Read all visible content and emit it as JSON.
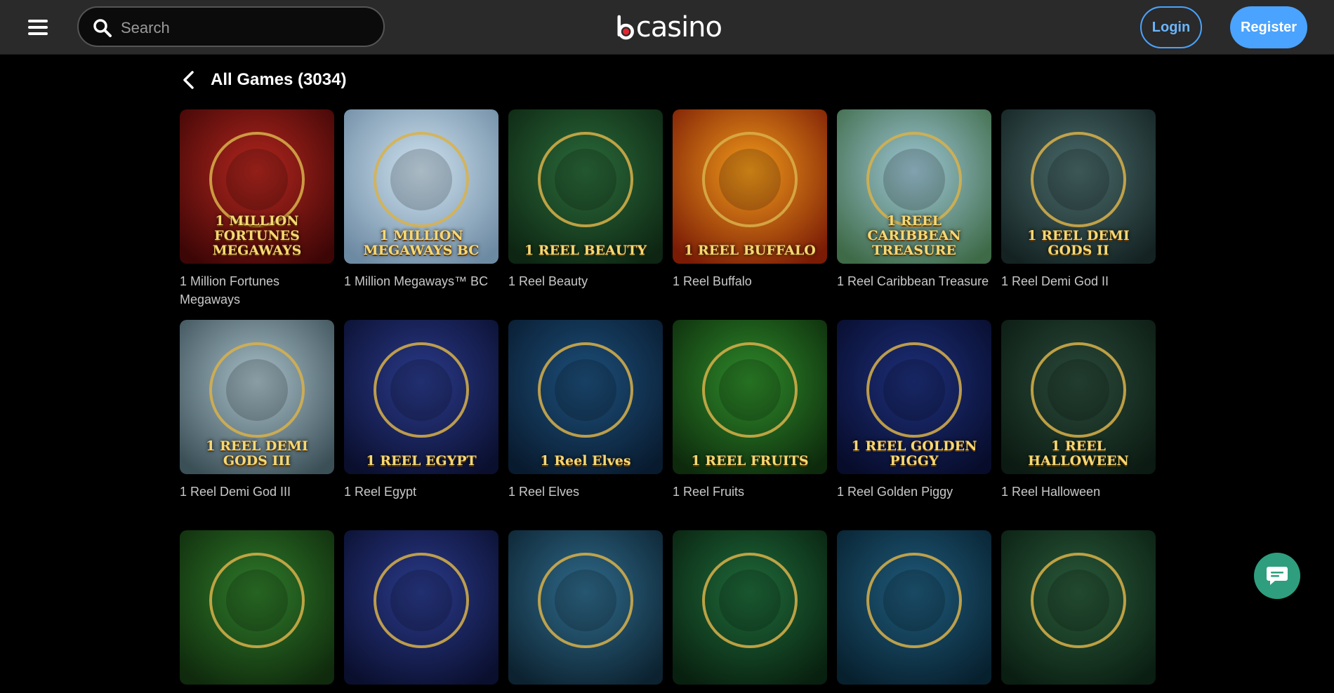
{
  "header": {
    "search_placeholder": "Search",
    "logo_text": "casino",
    "login_label": "Login",
    "register_label": "Register"
  },
  "page": {
    "title": "All Games (3034)"
  },
  "games": [
    {
      "name": "1 Million Fortunes Megaways",
      "thumb_text": "1 MILLION FORTUNES MEGAWAYS",
      "c1": "#b3261e",
      "c2": "#3d0606"
    },
    {
      "name": "1 Million Megaways™ BC",
      "thumb_text": "1 MILLION MEGAWAYS BC",
      "c1": "#cfe3f0",
      "c2": "#6d8aa3"
    },
    {
      "name": "1 Reel Beauty",
      "thumb_text": "1 REEL BEAUTY",
      "c1": "#2b6b3a",
      "c2": "#0d2512"
    },
    {
      "name": "1 Reel Buffalo",
      "thumb_text": "1 REEL BUFFALO",
      "c1": "#f19a1a",
      "c2": "#7a1b06"
    },
    {
      "name": "1 Reel Caribbean Treasure",
      "thumb_text": "1 REEL CARIBBEAN TREASURE",
      "c1": "#9ec6d6",
      "c2": "#3e6a47"
    },
    {
      "name": "1 Reel Demi God II",
      "thumb_text": "1 REEL DEMI GODS II",
      "c1": "#4a6a6a",
      "c2": "#142222"
    },
    {
      "name": "1 Reel Demi God III",
      "thumb_text": "1 REEL DEMI GODS III",
      "c1": "#a9c0c9",
      "c2": "#3b4f57"
    },
    {
      "name": "1 Reel Egypt",
      "thumb_text": "1 REEL EGYPT",
      "c1": "#2a3a8a",
      "c2": "#0a0f2e"
    },
    {
      "name": "1 Reel Elves",
      "thumb_text": "1 Reel Elves",
      "c1": "#1d4f7a",
      "c2": "#081a2e"
    },
    {
      "name": "1 Reel Fruits",
      "thumb_text": "1 REEL FRUITS",
      "c1": "#2e8a2a",
      "c2": "#0d2a0c"
    },
    {
      "name": "1 Reel Golden Piggy",
      "thumb_text": "1 REEL GOLDEN PIGGY",
      "c1": "#1d2f7a",
      "c2": "#070c2a"
    },
    {
      "name": "1 Reel Halloween",
      "thumb_text": "1 REEL HALLOWEEN",
      "c1": "#2a4a3a",
      "c2": "#0b1a12"
    },
    {
      "name": "",
      "thumb_text": "",
      "c1": "#2f7a2a",
      "c2": "#0f2a0c"
    },
    {
      "name": "",
      "thumb_text": "",
      "c1": "#2a3a8a",
      "c2": "#0a0f2e"
    },
    {
      "name": "",
      "thumb_text": "",
      "c1": "#2f6a8a",
      "c2": "#0c2230"
    },
    {
      "name": "",
      "thumb_text": "",
      "c1": "#1f6a3a",
      "c2": "#08200f"
    },
    {
      "name": "",
      "thumb_text": "",
      "c1": "#1f5a7a",
      "c2": "#07202e"
    },
    {
      "name": "",
      "thumb_text": "",
      "c1": "#2a5a3a",
      "c2": "#0a1e12"
    }
  ],
  "colors": {
    "accent": "#4aa3ff",
    "header_bg": "#2a2a2a",
    "chat": "#2e9e7e"
  }
}
